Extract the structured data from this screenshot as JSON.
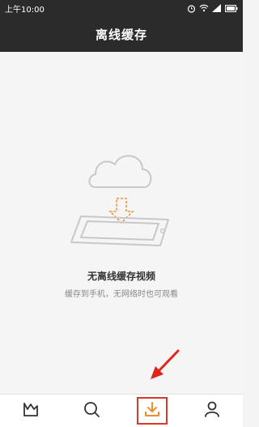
{
  "status_bar": {
    "time": "上午10:00",
    "icons": [
      "alarm-icon",
      "wifi-icon",
      "signal-icon",
      "battery-icon"
    ]
  },
  "header": {
    "title": "离线缓存"
  },
  "empty_state": {
    "illustration": "cloud-download-to-phone-icon",
    "title": "无离线缓存视频",
    "subtitle": "缓存到手机，无网络时也可观看"
  },
  "bottom_nav": {
    "items": [
      {
        "icon": "home-logo-icon",
        "active": false
      },
      {
        "icon": "search-icon",
        "active": false
      },
      {
        "icon": "download-icon",
        "active": true
      },
      {
        "icon": "user-icon",
        "active": false
      }
    ]
  },
  "colors": {
    "status_bar_bg": "#2b2b2b",
    "header_bg": "#2b2b2b",
    "accent": "#f08c32",
    "highlight_border": "#d9382c",
    "annotation_arrow": "#e0261b",
    "page_bg": "#f5f5f5"
  }
}
